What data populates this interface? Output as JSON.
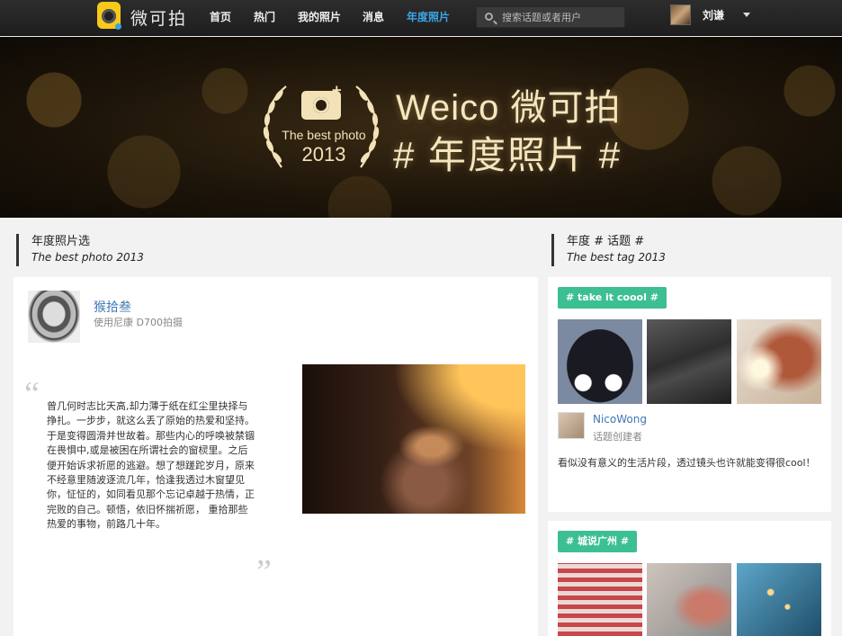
{
  "nav": {
    "logo_text": "微可拍",
    "items": [
      {
        "label": "首页",
        "active": false
      },
      {
        "label": "热门",
        "active": false
      },
      {
        "label": "我的照片",
        "active": false
      },
      {
        "label": "消息",
        "active": false
      },
      {
        "label": "年度照片",
        "active": true
      }
    ],
    "search_placeholder": "搜索话题或者用户",
    "username": "刘谦"
  },
  "banner": {
    "best_photo": "The best photo",
    "year": "2013",
    "title": "Weico 微可拍",
    "tag": "# 年度照片 #"
  },
  "left_section": {
    "title": "年度照片选",
    "subtitle": "The best photo 2013"
  },
  "right_section": {
    "title": "年度 # 话题 #",
    "subtitle": "The best tag 2013"
  },
  "post": {
    "author": "猴拾叁",
    "device": "使用尼康 D700拍摄",
    "quote_open": "“",
    "quote_close": "”",
    "text": "曾几何时志比天高,却力薄于纸在红尘里抉择与挣扎。一步步，就这么丢了原始的热爱和坚持。于是变得圆滑并世故着。那些内心的呼唤被禁锢在畏惧中,或是被困在所谓社会的窗棂里。之后便开始诉求祈愿的逃避。想了想蹉跎岁月，原来不经意里随波逐流几年，恰逢我透过木窗望见你，怔怔的，如同看见那个忘记卓越于热情，正完败的自己。顿悟，依旧怀揣祈愿， 重拾那些热爱的事物，前路几十年。"
  },
  "topics": [
    {
      "tag": "# take it coool #",
      "creator": "NicoWong",
      "creator_role": "话题创建者",
      "description": "看似没有意义的生活片段，透过镜头也许就能变得很cool！"
    },
    {
      "tag": "# 城说广州 #"
    }
  ],
  "colors": {
    "accent": "#3aa7e8",
    "tag_green": "#3cbf93",
    "link_blue": "#3f77b5"
  }
}
